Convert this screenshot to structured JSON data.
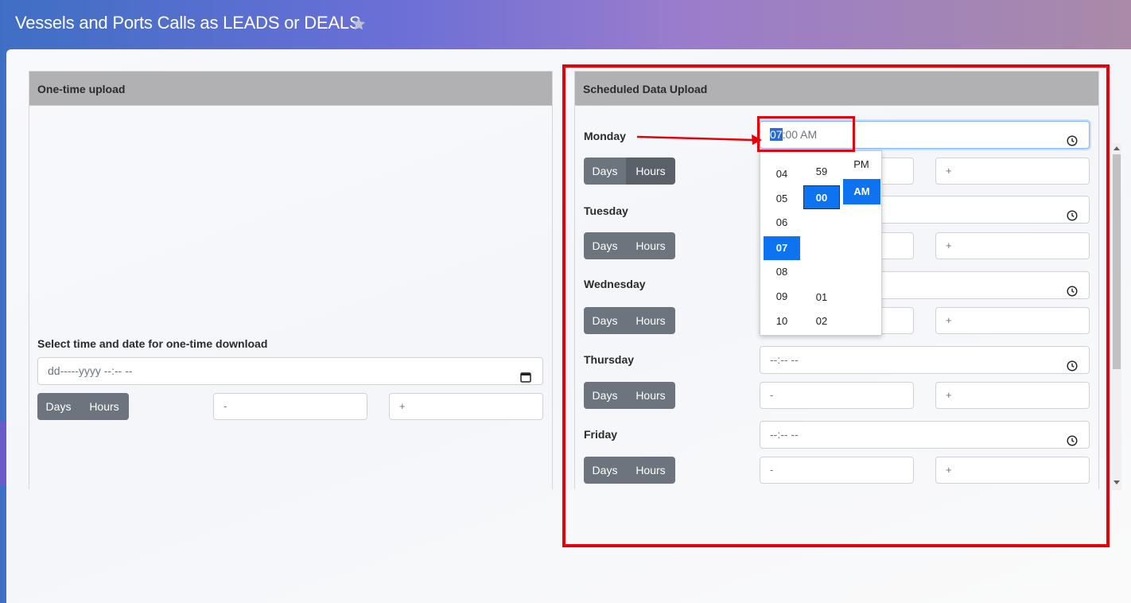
{
  "app": {
    "title": "Vessels and Ports Calls as LEADS or DEALS"
  },
  "colors": {
    "header_gray": "#b1b0b3",
    "button_gray": "#6c757d",
    "selected_blue": "#0d73f0",
    "annotation_red": "#e6000a"
  },
  "one_time": {
    "header": "One-time upload",
    "select_label": "Select time and date for one-time download",
    "datetime_placeholder": "dd-----yyyy --:-- --",
    "days_label": "Days",
    "hours_label": "Hours",
    "minus_placeholder": "-",
    "plus_placeholder": "+"
  },
  "scheduled": {
    "header": "Scheduled Data Upload",
    "monday": {
      "label": "Monday",
      "time_hour": "07",
      "time_rest": ":00 AM",
      "days_label": "Days",
      "hours_label": "Hours",
      "plus_placeholder": "+"
    },
    "tuesday": {
      "label": "Tuesday",
      "days_label": "Days",
      "hours_label": "Hours",
      "plus_placeholder": "+"
    },
    "wednesday": {
      "label": "Wednesday",
      "days_label": "Days",
      "hours_label": "Hours",
      "plus_placeholder": "+"
    },
    "thursday": {
      "label": "Thursday",
      "time_placeholder": "--:-- --",
      "days_label": "Days",
      "hours_label": "Hours",
      "minus_placeholder": "-",
      "plus_placeholder": "+"
    },
    "friday": {
      "label": "Friday",
      "time_placeholder": "--:-- --",
      "days_label": "Days",
      "hours_label": "Hours",
      "minus_placeholder": "-",
      "plus_placeholder": "+"
    }
  },
  "time_picker": {
    "hours": [
      "04",
      "05",
      "06",
      "07",
      "08",
      "09",
      "10"
    ],
    "selected_hour": "07",
    "minutes_top": [
      "59"
    ],
    "selected_minute": "00",
    "minutes_bottom": [
      "01",
      "02"
    ],
    "period_other": "PM",
    "selected_period": "AM"
  },
  "icons": {
    "favorite": "star-icon",
    "clock": "clock-icon",
    "calendar": "calendar-icon"
  }
}
